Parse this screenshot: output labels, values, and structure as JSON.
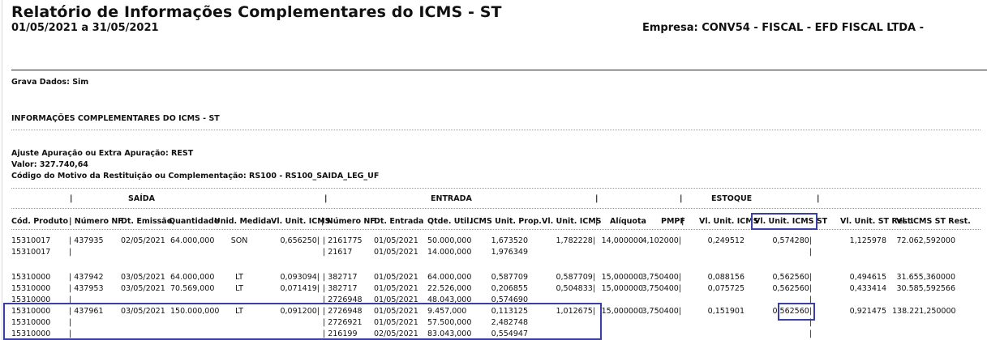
{
  "report": {
    "title": "Relatório de Informações Complementares do ICMS - ST",
    "period": "01/05/2021 a 31/05/2021",
    "company": "Empresa: CONV54 - FISCAL - EFD FISCAL LTDA -"
  },
  "info": {
    "grava": "Grava Dados: Sim",
    "section": "INFORMAÇÕES COMPLEMENTARES DO ICMS - ST",
    "ajuste": "Ajuste Apuração ou Extra Apuração: REST",
    "valor": "Valor: 327.740,64",
    "codigo": "Código do Motivo da Restituição ou Complementação: RS100 - RS100_SAIDA_LEG_UF"
  },
  "groups": {
    "saida": "SAÍDA",
    "entrada": "ENTRADA",
    "estoque": "ESTOQUE"
  },
  "columns": {
    "cod": "Cód. Produto",
    "nf": "| Número NF",
    "dt_emissao": "Dt. Emissão",
    "quantidade": "Quantidade",
    "unid": "Unid. Medida",
    "vl_unit_icms": "Vl. Unit. ICMS",
    "nf_entrada": "| Número NF",
    "dt_entrada": "Dt. Entrada",
    "qtde_util": "Qtde. Util.",
    "icms_unit_prop": "ICMS Unit. Prop.",
    "vl_unit_icms_e": "Vl. Unit. ICMS",
    "aliquota": "Alíquota",
    "pmpf": "PMPF",
    "vl_unit_icms_est": "Vl. Unit. ICMS",
    "vl_unit_icms_st": "Vl. Unit. ICMS ST",
    "vl_unit_st_rest": "Vl. Unit. ST Rest.",
    "vl_icms_st_rest": "Vl. ICMS ST Rest."
  },
  "rows": [
    {
      "cod": "15310017",
      "nf": "437935",
      "dt": "02/05/2021",
      "qtd": "64.000,000",
      "un": "SON",
      "vu": "0,656250",
      "nfe": "2161775",
      "dte": "01/05/2021",
      "qu": "50.000,000",
      "ip": "1,673520",
      "vue": "1,782228",
      "al": "14,000000",
      "pm": "4,102000",
      "vus": "0,249512",
      "vst": "0,574280",
      "vsr": "1,125978",
      "vir": "72.062,592000"
    },
    {
      "cod": "15310017",
      "nf": "",
      "dt": "",
      "qtd": "",
      "un": "",
      "vu": "",
      "nfe": "21617",
      "dte": "01/05/2021",
      "qu": "14.000,000",
      "ip": "1,976349",
      "vue": "",
      "al": "",
      "pm": "",
      "vus": "",
      "vst": "",
      "vsr": "",
      "vir": ""
    },
    {
      "cod": "15310000",
      "nf": "437942",
      "dt": "03/05/2021",
      "qtd": "64.000,000",
      "un": "LT",
      "vu": "0,093094",
      "nfe": "382717",
      "dte": "01/05/2021",
      "qu": "64.000,000",
      "ip": "0,587709",
      "vue": "0,587709",
      "al": "15,000000",
      "pm": "3,750400",
      "vus": "0,088156",
      "vst": "0,562560",
      "vsr": "0,494615",
      "vir": "31.655,360000"
    },
    {
      "cod": "15310000",
      "nf": "437953",
      "dt": "03/05/2021",
      "qtd": "70.569,000",
      "un": "LT",
      "vu": "0,071419",
      "nfe": "382717",
      "dte": "01/05/2021",
      "qu": "22.526,000",
      "ip": "0,206855",
      "vue": "0,504833",
      "al": "15,000000",
      "pm": "3,750400",
      "vus": "0,075725",
      "vst": "0,562560",
      "vsr": "0,433414",
      "vir": "30.585,592566"
    },
    {
      "cod": "15310000",
      "nf": "",
      "dt": "",
      "qtd": "",
      "un": "",
      "vu": "",
      "nfe": "2726948",
      "dte": "01/05/2021",
      "qu": "48.043,000",
      "ip": "0,574690",
      "vue": "",
      "al": "",
      "pm": "",
      "vus": "",
      "vst": "",
      "vsr": "",
      "vir": ""
    },
    {
      "cod": "15310000",
      "nf": "437961",
      "dt": "03/05/2021",
      "qtd": "150.000,000",
      "un": "LT",
      "vu": "0,091200",
      "nfe": "2726948",
      "dte": "01/05/2021",
      "qu": "9.457,000",
      "ip": "0,113125",
      "vue": "1,012675",
      "al": "15,000000",
      "pm": "3,750400",
      "vus": "0,151901",
      "vst": "0,562560",
      "vsr": "0,921475",
      "vir": "138.221,250000"
    },
    {
      "cod": "15310000",
      "nf": "",
      "dt": "",
      "qtd": "",
      "un": "",
      "vu": "",
      "nfe": "2726921",
      "dte": "01/05/2021",
      "qu": "57.500,000",
      "ip": "2,482748",
      "vue": "",
      "al": "",
      "pm": "",
      "vus": "",
      "vst": "",
      "vsr": "",
      "vir": ""
    },
    {
      "cod": "15310000",
      "nf": "",
      "dt": "",
      "qtd": "",
      "un": "",
      "vu": "",
      "nfe": "216199",
      "dte": "02/05/2021",
      "qu": "83.043,000",
      "ip": "0,554947",
      "vue": "",
      "al": "",
      "pm": "",
      "vus": "",
      "vst": "",
      "vsr": "",
      "vir": ""
    }
  ],
  "highlight_color": "#3a3fa3"
}
